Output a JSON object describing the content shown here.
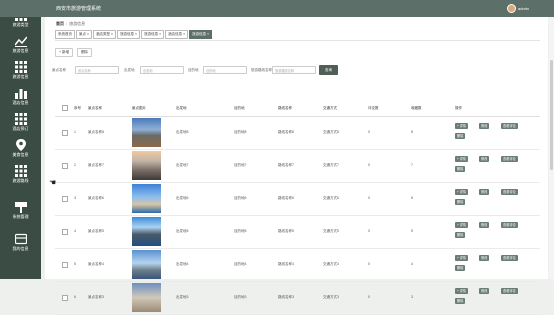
{
  "header": {
    "title": "西安市旅游管理系统",
    "user": "admin"
  },
  "sidebar": {
    "items": [
      {
        "label": "旅游类型",
        "icon": "grid-icon"
      },
      {
        "label": "旅游信息",
        "icon": "chart-icon"
      },
      {
        "label": "旅游信息",
        "icon": "grid-icon"
      },
      {
        "label": "酒店信息",
        "icon": "bars-icon"
      },
      {
        "label": "酒店预订",
        "icon": "grid-icon"
      },
      {
        "label": "美食信息",
        "icon": "pin-icon"
      },
      {
        "label": "旅游路线",
        "icon": "grid-icon"
      },
      {
        "label": "系统管理",
        "icon": "pen-icon"
      },
      {
        "label": "我的信息",
        "icon": "wallet-icon"
      }
    ]
  },
  "breadcrumb": {
    "home": "首页",
    "current": "旅游信息"
  },
  "tabs": [
    {
      "label": "系统首页",
      "active": false
    },
    {
      "label": "景点 ×",
      "active": false
    },
    {
      "label": "酒店类型 ×",
      "active": false
    },
    {
      "label": "旅游信息 ×",
      "active": false
    },
    {
      "label": "旅游信息 ×",
      "active": false
    },
    {
      "label": "酒店信息 ×",
      "active": false
    },
    {
      "label": "旅游信息 ×",
      "active": true
    }
  ],
  "actions": {
    "add": "+ 新增",
    "delete": "删除"
  },
  "search": {
    "field1_label": "景点名称",
    "field1_placeholder": "景点名称",
    "field2_label": "出发地",
    "field2_placeholder": "出发地",
    "field3_label": "目的地",
    "field3_placeholder": "目的地",
    "field4_label": "旅游路线名称",
    "field4_placeholder": "旅游路线名称",
    "button": "查询"
  },
  "table": {
    "columns": [
      "序号",
      "景点名称",
      "景点图片",
      "出发地",
      "目的地",
      "路线名称",
      "交通方式",
      "评论数",
      "收藏数",
      "操作"
    ],
    "rows": [
      {
        "no": "1",
        "name": "景点名称8",
        "from": "出发地8",
        "to": "目的地8",
        "route": "路线名称8",
        "transport": "交通方式8",
        "comments": "0",
        "favorites": "8"
      },
      {
        "no": "2",
        "name": "景点名称7",
        "from": "出发地7",
        "to": "目的地7",
        "route": "路线名称7",
        "transport": "交通方式7",
        "comments": "0",
        "favorites": "7"
      },
      {
        "no": "3",
        "name": "景点名称6",
        "from": "出发地6",
        "to": "目的地6",
        "route": "路线名称6",
        "transport": "交通方式6",
        "comments": "0",
        "favorites": "6"
      },
      {
        "no": "4",
        "name": "景点名称5",
        "from": "出发地5",
        "to": "目的地5",
        "route": "路线名称5",
        "transport": "交通方式5",
        "comments": "0",
        "favorites": "5"
      },
      {
        "no": "5",
        "name": "景点名称4",
        "from": "出发地4",
        "to": "目的地4",
        "route": "路线名称4",
        "transport": "交通方式4",
        "comments": "0",
        "favorites": "4"
      },
      {
        "no": "6",
        "name": "景点名称3",
        "from": "出发地3",
        "to": "目的地3",
        "route": "路线名称3",
        "transport": "交通方式3",
        "comments": "0",
        "favorites": "3"
      }
    ],
    "ops": {
      "detail": "+ 详情",
      "edit": "修改",
      "review": "查看评论",
      "delete": "删除"
    }
  },
  "colors": {
    "header": "#5c6f68",
    "sidebar": "#3b4c44",
    "button": "#6a7c73"
  }
}
